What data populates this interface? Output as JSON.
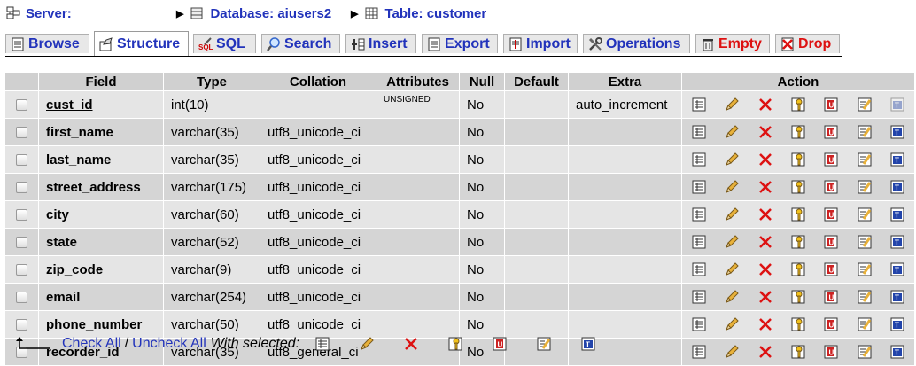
{
  "breadcrumb": {
    "server_label": "Server:",
    "database_label": "Database: aiusers2",
    "table_label": "Table: customer"
  },
  "tabs": [
    {
      "label": "Browse",
      "icon": "browse-icon",
      "active": false
    },
    {
      "label": "Structure",
      "icon": "structure-icon",
      "active": true
    },
    {
      "label": "SQL",
      "icon": "sql-icon",
      "active": false
    },
    {
      "label": "Search",
      "icon": "search-icon",
      "active": false
    },
    {
      "label": "Insert",
      "icon": "insert-icon",
      "active": false
    },
    {
      "label": "Export",
      "icon": "export-icon",
      "active": false
    },
    {
      "label": "Import",
      "icon": "import-icon",
      "active": false
    },
    {
      "label": "Operations",
      "icon": "operations-icon",
      "active": false
    },
    {
      "label": "Empty",
      "icon": "empty-icon",
      "active": false
    },
    {
      "label": "Drop",
      "icon": "drop-icon",
      "active": false
    }
  ],
  "columns": [
    "Field",
    "Type",
    "Collation",
    "Attributes",
    "Null",
    "Default",
    "Extra",
    "Action"
  ],
  "rows": [
    {
      "field": "cust_id",
      "type": "int(10)",
      "collation": "",
      "attributes": "UNSIGNED",
      "null": "No",
      "default": "",
      "extra": "auto_increment",
      "primary": true
    },
    {
      "field": "first_name",
      "type": "varchar(35)",
      "collation": "utf8_unicode_ci",
      "attributes": "",
      "null": "No",
      "default": "",
      "extra": "",
      "primary": false
    },
    {
      "field": "last_name",
      "type": "varchar(35)",
      "collation": "utf8_unicode_ci",
      "attributes": "",
      "null": "No",
      "default": "",
      "extra": "",
      "primary": false
    },
    {
      "field": "street_address",
      "type": "varchar(175)",
      "collation": "utf8_unicode_ci",
      "attributes": "",
      "null": "No",
      "default": "",
      "extra": "",
      "primary": false
    },
    {
      "field": "city",
      "type": "varchar(60)",
      "collation": "utf8_unicode_ci",
      "attributes": "",
      "null": "No",
      "default": "",
      "extra": "",
      "primary": false
    },
    {
      "field": "state",
      "type": "varchar(52)",
      "collation": "utf8_unicode_ci",
      "attributes": "",
      "null": "No",
      "default": "",
      "extra": "",
      "primary": false
    },
    {
      "field": "zip_code",
      "type": "varchar(9)",
      "collation": "utf8_unicode_ci",
      "attributes": "",
      "null": "No",
      "default": "",
      "extra": "",
      "primary": false
    },
    {
      "field": "email",
      "type": "varchar(254)",
      "collation": "utf8_unicode_ci",
      "attributes": "",
      "null": "No",
      "default": "",
      "extra": "",
      "primary": false
    },
    {
      "field": "phone_number",
      "type": "varchar(50)",
      "collation": "utf8_unicode_ci",
      "attributes": "",
      "null": "No",
      "default": "",
      "extra": "",
      "primary": false
    },
    {
      "field": "recorder_id",
      "type": "varchar(35)",
      "collation": "utf8_general_ci",
      "attributes": "",
      "null": "No",
      "default": "",
      "extra": "",
      "primary": false
    }
  ],
  "row_actions": [
    "browse-distinct-icon",
    "edit-pencil-icon",
    "drop-x-icon",
    "primary-key-icon",
    "unique-icon",
    "index-icon",
    "fulltext-icon"
  ],
  "footer": {
    "check_all": "Check All",
    "separator": "/",
    "uncheck_all": "Uncheck All",
    "with_selected": "With selected:"
  },
  "colors": {
    "link": "#2233bb",
    "danger": "#dd1111",
    "header_bg": "#d0d0d0",
    "row_odd": "#e5e5e5",
    "row_even": "#d5d5d5"
  }
}
